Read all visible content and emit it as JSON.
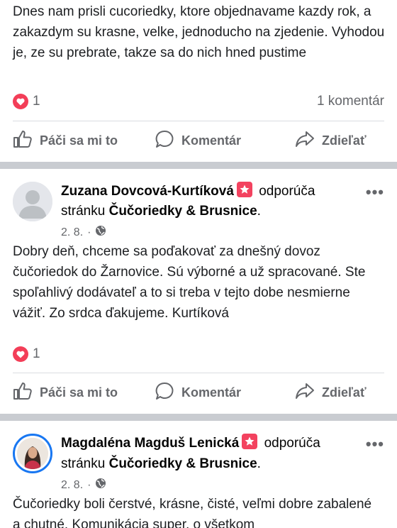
{
  "posts": [
    {
      "text": "Dnes nam prisli cucoriedky, ktore objednavame kazdy rok, a zakazdym su krasne, velke, jednoducho na zjedenie. Vyhodou je, ze su prebrate, takze sa do nich hned pustime",
      "reaction_count": "1",
      "comment_count": "1 komentár"
    },
    {
      "author": "Zuzana Dovcová-Kurtíková",
      "recommends": "odporúča",
      "page_prefix": "stránku",
      "page_name": "Čučoriedky & Brusnice",
      "date": "2. 8.",
      "text": "Dobry deň, chceme sa poďakovať za dnešný dovoz čučoriedok do Žarnovice. Sú výborné a už spracované. Ste spoľahlivý dodávateľ a to si treba v tejto dobe nesmierne vážiť. Zo srdca ďakujeme. Kurtíková",
      "reaction_count": "1"
    },
    {
      "author": "Magdaléna Magduš Lenická",
      "recommends": "odporúča",
      "page_prefix": "stránku",
      "page_name": "Čučoriedky & Brusnice",
      "date": "2. 8.",
      "text": "Čučoriedky boli čerstvé, krásne, čisté, veľmi dobre zabalené a chutné. Komunikácia super, o všetkom"
    }
  ],
  "actions": {
    "like": "Páči sa mi to",
    "comment": "Komentár",
    "share": "Zdieľať"
  },
  "more_label": "•••",
  "colors": {
    "accent_blue": "#1877f2",
    "heart_red": "#f33e58",
    "recommend_badge": "#f3425f",
    "secondary_text": "#65676b"
  },
  "icons": [
    "heart-icon",
    "like-icon",
    "comment-icon",
    "share-icon",
    "globe-icon",
    "recommend-star-icon",
    "more-icon"
  ]
}
